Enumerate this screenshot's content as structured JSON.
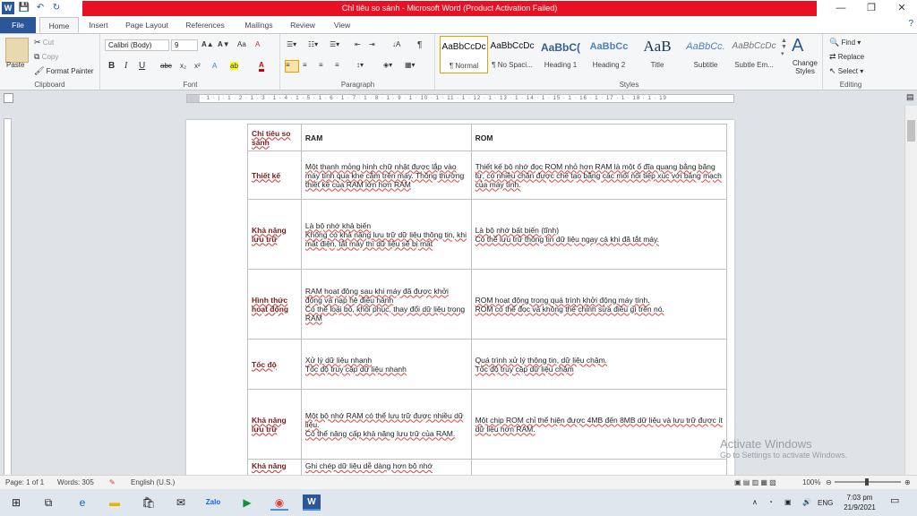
{
  "window": {
    "title": "Chỉ tiêu so sánh  -  Microsoft Word (Product Activation Failed)",
    "minimize": "—",
    "restore": "❐",
    "close": "✕"
  },
  "qat": {
    "word": "W",
    "save": "💾",
    "undo": "↶",
    "redo": "↻"
  },
  "tabs": [
    "File",
    "Home",
    "Insert",
    "Page Layout",
    "References",
    "Mailings",
    "Review",
    "View"
  ],
  "help": "?",
  "ribbon": {
    "clipboard": {
      "paste": "Paste",
      "cut": "Cut",
      "copy": "Copy",
      "format_painter": "Format Painter",
      "label": "Clipboard"
    },
    "font": {
      "name": "Calibri (Body)",
      "size": "9",
      "label": "Font",
      "bold": "B",
      "italic": "I",
      "underline": "U",
      "strike": "abc",
      "sub": "x₂",
      "sup": "x²",
      "grow": "A▲",
      "shrink": "A▼",
      "case": "Aa",
      "clear": "A",
      "highlight": "ab",
      "color": "A"
    },
    "paragraph": {
      "label": "Paragraph",
      "pilcrow": "¶",
      "sort": "↓A"
    },
    "styles": {
      "label": "Styles",
      "items": [
        {
          "preview": "AaBbCcDc",
          "name": "¶ Normal"
        },
        {
          "preview": "AaBbCcDc",
          "name": "¶ No Spaci..."
        },
        {
          "preview": "AaBbC(",
          "name": "Heading 1"
        },
        {
          "preview": "AaBbCc",
          "name": "Heading 2"
        },
        {
          "preview": "AaB",
          "name": "Title"
        },
        {
          "preview": "AaBbCc.",
          "name": "Subtitle"
        },
        {
          "preview": "AaBbCcDc",
          "name": "Subtle Em..."
        }
      ],
      "change_styles": "Change Styles"
    },
    "editing": {
      "find": "Find",
      "replace": "Replace",
      "select": "Select",
      "label": "Editing"
    }
  },
  "table": {
    "header": [
      "Chỉ tiêu so sánh",
      "RAM",
      "ROM"
    ],
    "rows": [
      {
        "label": "Thiết kế",
        "ram": "Một thanh mỏng hình chữ nhật được lắp vào máy tính qua khe cắm trên máy. Thông thường thiết kế của RAM lớn hơn RAM",
        "rom": "Thiết kế bộ nhớ đọc ROM nhỏ hơn RAM là một ổ đĩa quang bằng băng từ, có nhiều chân được chế tạo bằng các mối nối tiếp xúc với bảng mạch của máy tính."
      },
      {
        "label": "Khả năng lưu trữ",
        "ram": "Là bộ nhớ khả biến\nKhông có khả năng lưu trữ dữ liệu thông tin, khi mất điện, tắt máy thì dữ liệu sẽ bị mất",
        "rom": "Là bộ nhớ bất biến (tĩnh)\nCó thể lưu trữ thông tin dữ liệu ngay cả khi đã tắt máy."
      },
      {
        "label": "Hình thức hoạt động",
        "ram": "RAM hoạt động sau khi máy đã được khởi động và nạp hệ điều hành\nCó thể loại bỏ, khôi phục, thay đổi dữ liệu trong RAM",
        "rom": "ROM hoạt động trong quá trình khởi động máy tính.\nROM có thể đọc và không thể chỉnh sửa điều gì trên nó."
      },
      {
        "label": "Tốc độ",
        "ram": "Xử lý dữ liệu nhanh\nTốc độ truy cập dữ liệu nhanh",
        "rom": "Quá trình xử lý thông tin, dữ liệu chậm.\nTốc độ truy cập dữ liệu chậm"
      },
      {
        "label": "Khả năng lưu trữ",
        "ram": "Một bộ nhớ RAM có thể lưu trữ được nhiều dữ liệu.\nCó thể nâng cấp khả năng lưu trữ của RAM.",
        "rom": "Một chip ROM chỉ thể hiện được 4MB đến 8MB dữ liệu và lưu trữ được ít dữ liệu hơn RAM."
      },
      {
        "label": "Khả năng",
        "ram": "Ghi chép dữ liệu dễ dàng hơn bộ nhớ",
        "rom": ""
      }
    ]
  },
  "watermark": {
    "line1": "Activate Windows",
    "line2": "Go to Settings to activate Windows."
  },
  "status": {
    "page": "Page: 1 of 1",
    "words": "Words: 305",
    "language": "English (U.S.)",
    "zoom": "100%"
  },
  "taskbar": {
    "time": "7:03 pm",
    "date": "21/9/2021",
    "lang": "ENG"
  }
}
